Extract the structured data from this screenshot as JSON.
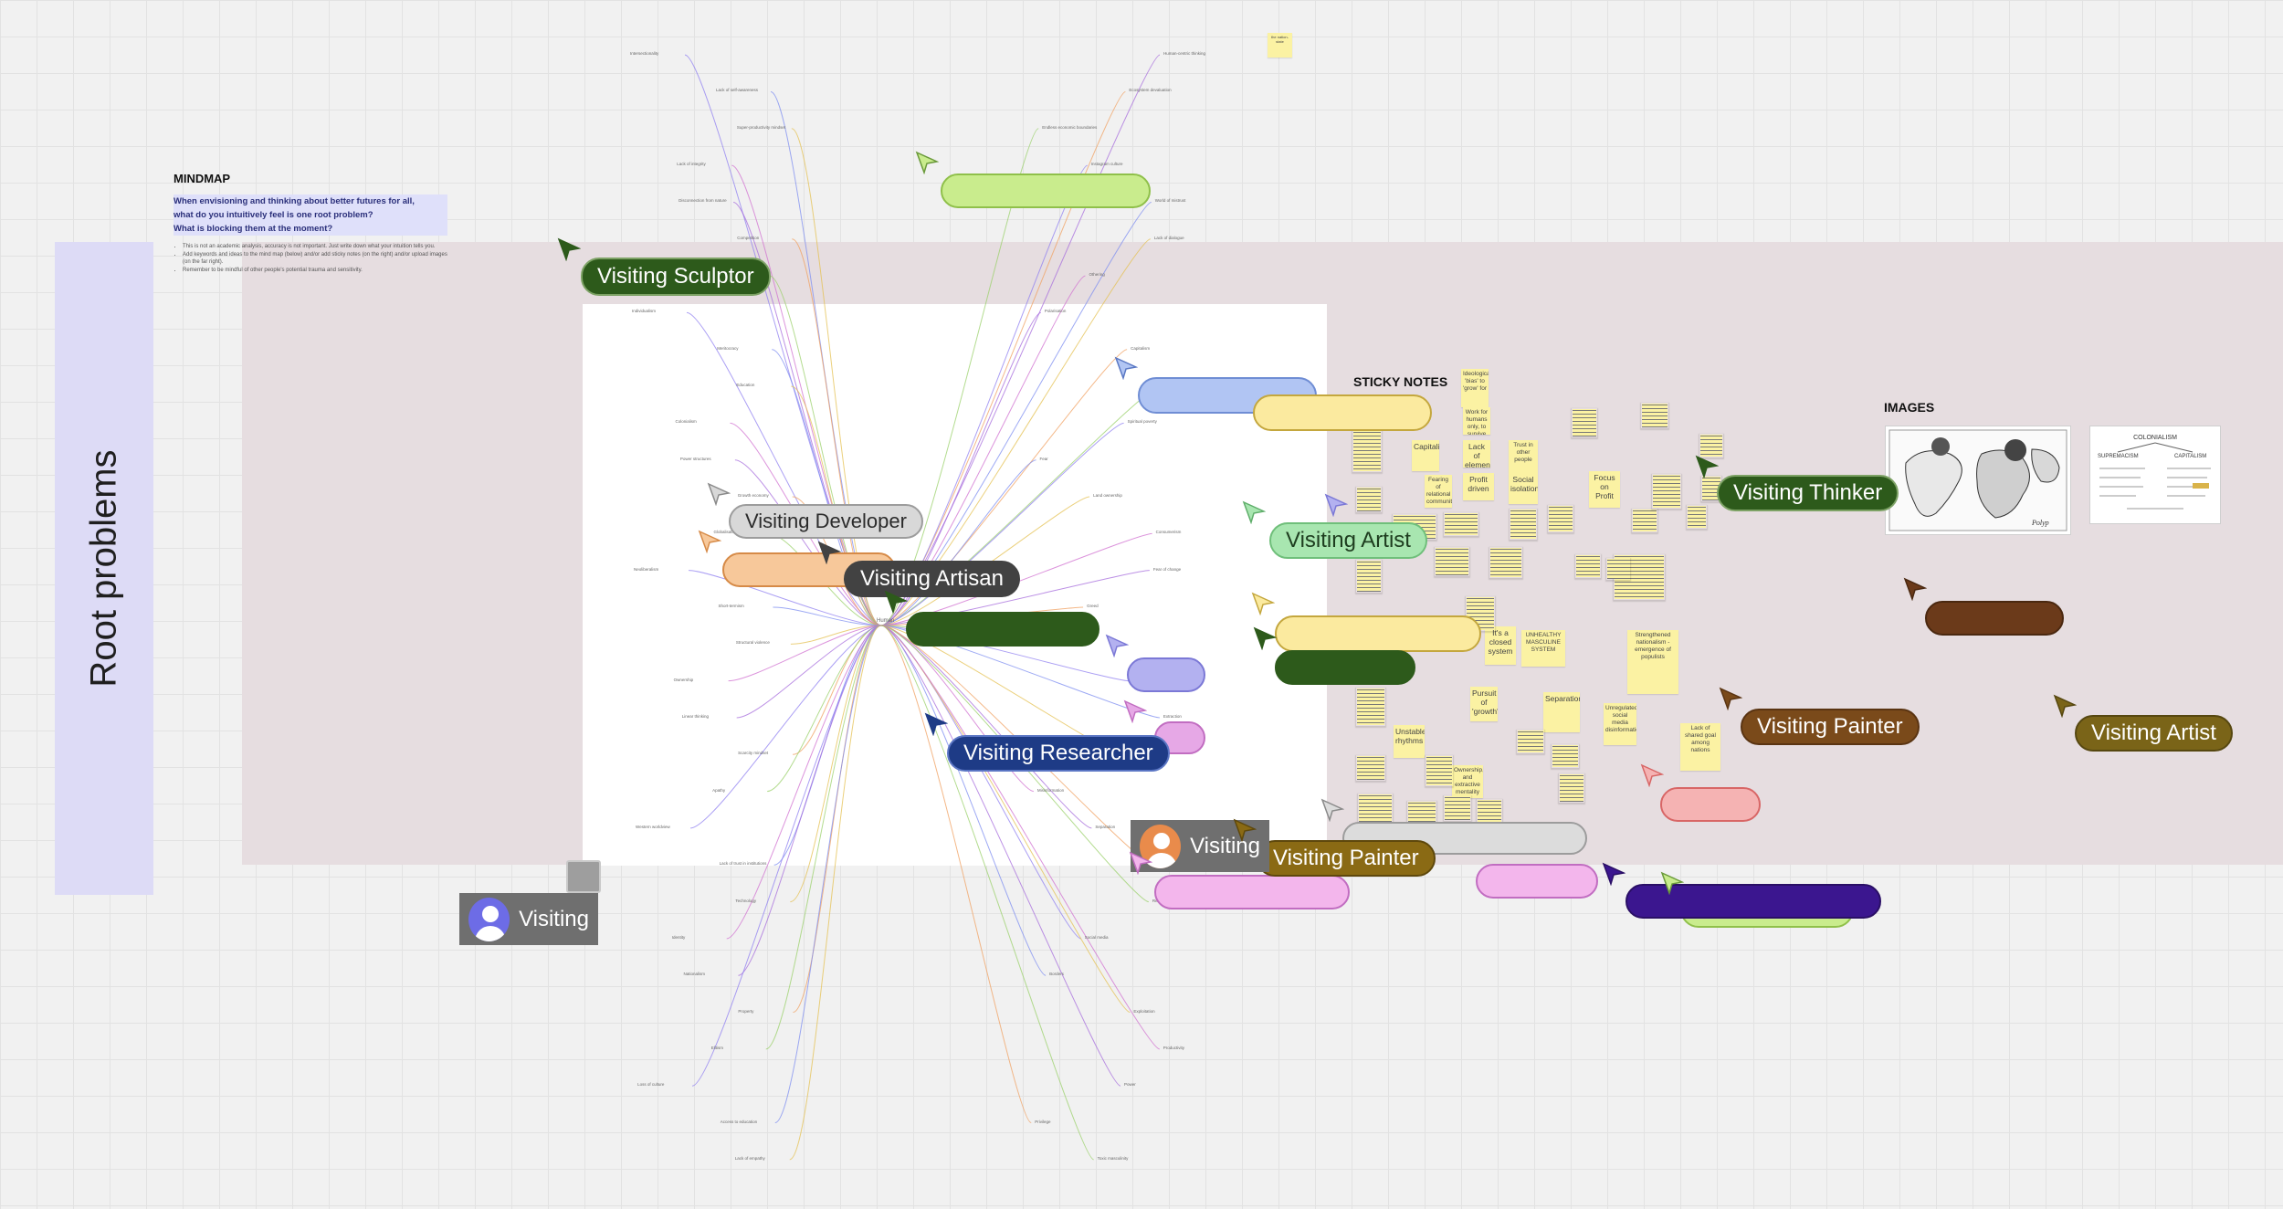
{
  "board": {
    "root_title": "Root problems",
    "mindmap_title": "MINDMAP",
    "question_lines": [
      "When envisioning and thinking about better futures for all,",
      "what do you intuitively feel is one root problem?",
      "What is blocking them at the moment?"
    ],
    "instructions": [
      "This is not an academic analysis, accuracy is not important. Just write down what your intuition tells you.",
      "Add keywords and ideas to the mind map (below) and/or add sticky notes (on the right) and/or upload images (on the far right).",
      "Remember to be mindful of other people's potential trauma and sensitivity."
    ],
    "sticky_notes_title": "STICKY NOTES",
    "images_title": "IMAGES",
    "center_node": "Human",
    "top_sticky": "the nation-state"
  },
  "mindmap_nodes": [
    "Intersectionality",
    "Human-centric thinking",
    "Lack of self-awareness",
    "Ecosystem devaluation",
    "Super-productivity mindset",
    "Endless economic boundaries",
    "Lack of integrity",
    "Instagram culture",
    "Disconnection from nature",
    "World of mistrust",
    "Competition",
    "Lack of dialogue",
    "Hierarchies",
    "Othering",
    "Individualism",
    "Polarisation",
    "Meritocracy",
    "Capitalism",
    "Education",
    "Patriarchy",
    "Colonialism",
    "Spiritual poverty",
    "Power structures",
    "Fear",
    "Growth economy",
    "Land ownership",
    "Globalisation",
    "Consumerism",
    "Neoliberalism",
    "Fear of change",
    "Short-termism",
    "Greed",
    "Structural violence",
    "Mental health",
    "Ownership",
    "History of hate",
    "Linear thinking",
    "Extraction",
    "Scarcity mindset",
    "Monoculture",
    "Apathy",
    "Misinformation",
    "Western worldview",
    "Separation",
    "Lack of trust in institutions",
    "Wealth inequality",
    "Technology",
    "Religion",
    "Identity",
    "Social media",
    "Nationalism",
    "Borders",
    "Property",
    "Exploitation",
    "Elitism",
    "Productivity",
    "Loss of culture",
    "Power",
    "Access to education",
    "Privilege",
    "Lack of empathy",
    "Toxic masculinity"
  ],
  "stickies": [
    {
      "text": "Ideological 'bias' to 'grow' for"
    },
    {
      "text": "Work for humans only, to survive things"
    },
    {
      "text": "Capitalism"
    },
    {
      "text": "Lack of elements"
    },
    {
      "text": "Trust in other people"
    },
    {
      "text": "Profit driven"
    },
    {
      "text": "Social isolation"
    },
    {
      "text": "Fearing of relational community"
    },
    {
      "text": "Focus on Profit"
    },
    {
      "text": "It's a closed system"
    },
    {
      "text": "UNHEALTHY MASCULINE SYSTEM"
    },
    {
      "text": "Strengthened nationalism - emergence of populists"
    },
    {
      "text": "Pursuit of 'growth'"
    },
    {
      "text": "Separation"
    },
    {
      "text": "Unregulated social media disinformation"
    },
    {
      "text": "Lack of shared goal among nations"
    },
    {
      "text": "Unstable rhythms"
    },
    {
      "text": "Ownership, and extractive mentality"
    }
  ],
  "images": [
    {
      "name": "world-map-drawing",
      "title": ""
    },
    {
      "name": "colonialism-diagram",
      "title": "COLONIALISM",
      "labels": [
        "SUPREMACISM",
        "CAPITALISM"
      ]
    }
  ],
  "presence": [
    {
      "id": "sculptor",
      "label": "Visiting Sculptor",
      "bg": "#2d5a1b",
      "fg": "#ffffff",
      "border": "#7da265"
    },
    {
      "id": "developer",
      "label": "Visiting Developer",
      "bg": "#d8d8d8",
      "fg": "#2b2b2b",
      "border": "#9c9c9c"
    },
    {
      "id": "artisan",
      "label": "Visiting Artisan",
      "bg": "#424242",
      "fg": "#ffffff",
      "border": "#424242"
    },
    {
      "id": "artist-light",
      "label": "Visiting Artist",
      "bg": "#a8e6b0",
      "fg": "#1e3d1f",
      "border": "#6fbf7a"
    },
    {
      "id": "thinker",
      "label": "Visiting Thinker",
      "bg": "#2d5a1b",
      "fg": "#ffffff",
      "border": "#7da265"
    },
    {
      "id": "researcher",
      "label": "Visiting Researcher",
      "bg": "#1e3b86",
      "fg": "#ffffff",
      "border": "#5b76c4"
    },
    {
      "id": "painter-1",
      "label": "Visiting Painter",
      "bg": "#7a4a1a",
      "fg": "#ffffff",
      "border": "#5a3412"
    },
    {
      "id": "painter-2",
      "label": "Visiting Painter",
      "bg": "#8a6a14",
      "fg": "#ffffff",
      "border": "#5e480c"
    },
    {
      "id": "artist-olive",
      "label": "Visiting Artist",
      "bg": "#7a6418",
      "fg": "#ffffff",
      "border": "#564710"
    }
  ],
  "visitors": [
    {
      "label": "Visiting",
      "avatar_color": "#6d6ce6"
    },
    {
      "label": "Visiting",
      "avatar_color": "#e98b4b"
    }
  ]
}
